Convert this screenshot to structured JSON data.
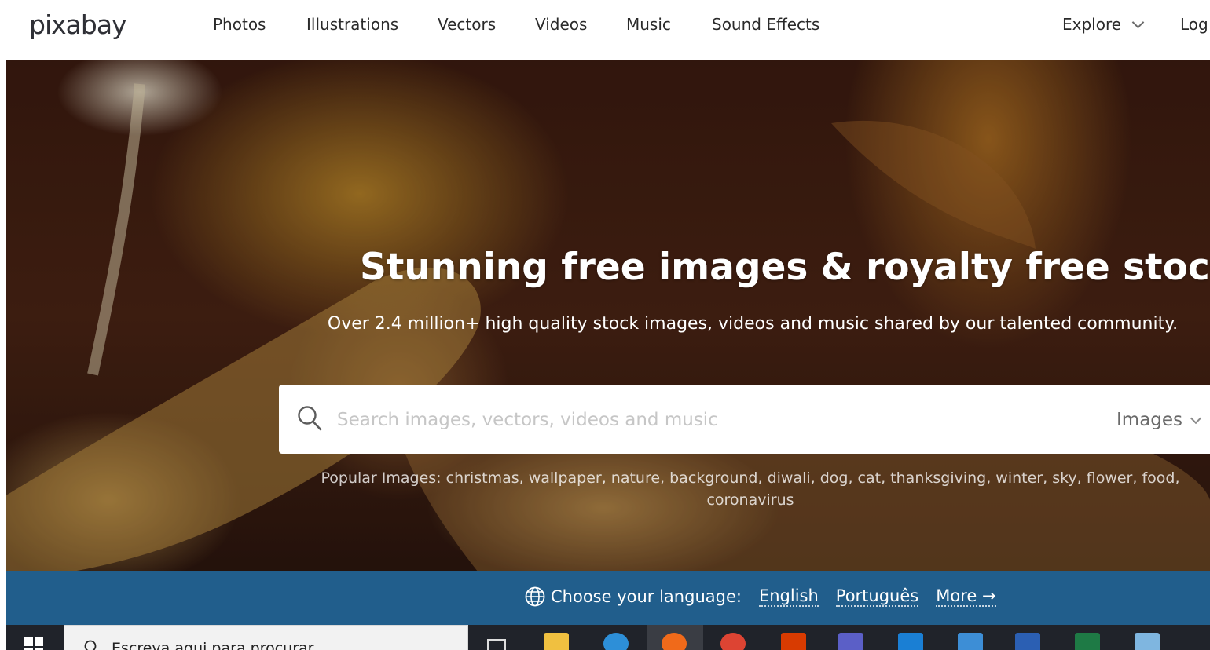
{
  "header": {
    "logo": "pixabay",
    "nav": [
      "Photos",
      "Illustrations",
      "Vectors",
      "Videos",
      "Music",
      "Sound Effects"
    ],
    "explore": "Explore",
    "login": "Log"
  },
  "hero": {
    "title": "Stunning free images & royalty free stock",
    "subtitle": "Over 2.4 million+ high quality stock images, videos and music shared by our talented community.",
    "search": {
      "placeholder": "Search images, vectors, videos and music",
      "value": "",
      "type_selected": "Images"
    },
    "popular_label": "Popular Images:",
    "popular_terms": "christmas, wallpaper, nature, background, diwali, dog, cat, thanksgiving, winter, sky, flower, food, coronavirus"
  },
  "language_bar": {
    "label": "Choose your language:",
    "options": [
      "English",
      "Português"
    ],
    "more": "More →"
  },
  "taskbar": {
    "search_text": "Escreva aqui para procurar",
    "apps": [
      "task-view-icon",
      "file-explorer-icon",
      "internet-explorer-icon",
      "firefox-icon",
      "chrome-icon",
      "office-icon",
      "teams-icon",
      "mail-icon",
      "remote-desktop-icon",
      "word-icon",
      "excel-icon",
      "notes-icon"
    ]
  },
  "colors": {
    "language_bar_bg": "#215e8c",
    "taskbar_bg": "#20232a"
  }
}
